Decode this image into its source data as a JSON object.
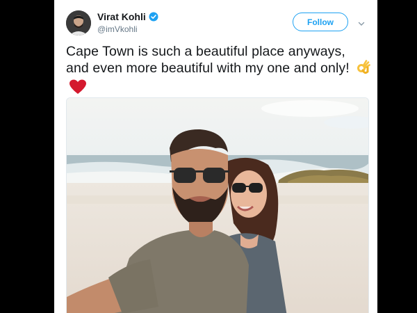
{
  "tweet": {
    "author_name": "Virat Kohli",
    "author_handle": "@imVkohli",
    "follow_label": "Follow",
    "text": "Cape Town is such a beautiful place anyways, and even more beautiful with my one and only!",
    "icons": {
      "verified": "verified-badge-icon",
      "menu": "chevron-down-icon",
      "emoji_ok": "ok-hand-emoji",
      "emoji_heart": "red-heart-emoji"
    }
  },
  "colors": {
    "accent": "#1da1f2",
    "text": "#14171a",
    "muted": "#657786",
    "heart": "#e0245e"
  }
}
